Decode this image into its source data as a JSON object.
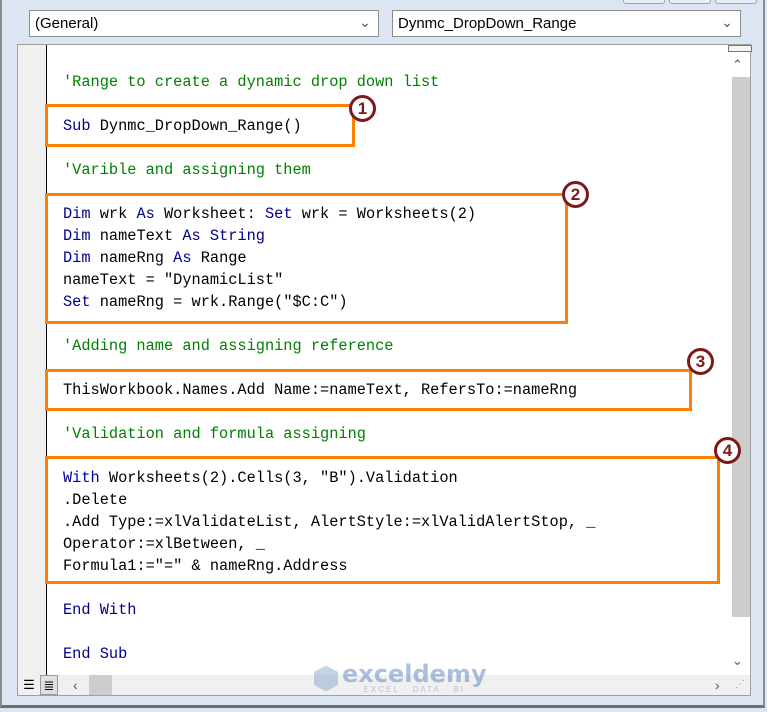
{
  "window": {
    "object_combo": "(General)",
    "procedure_combo": "Dynmc_DropDown_Range"
  },
  "code": {
    "lines": [
      {
        "segments": [
          {
            "t": "'Range to create a dynamic drop down list",
            "c": "cm"
          }
        ]
      },
      {
        "segments": [
          {
            "t": "Sub",
            "c": "kw"
          },
          {
            "t": " Dynmc_DropDown_Range()",
            "c": ""
          }
        ]
      },
      {
        "segments": [
          {
            "t": "'Varible and assigning them",
            "c": "cm"
          }
        ]
      },
      {
        "segments": [
          {
            "t": "Dim",
            "c": "kw"
          },
          {
            "t": " wrk ",
            "c": ""
          },
          {
            "t": "As",
            "c": "kw"
          },
          {
            "t": " Worksheet: ",
            "c": ""
          },
          {
            "t": "Set",
            "c": "kw"
          },
          {
            "t": " wrk = Worksheets(2)",
            "c": ""
          }
        ]
      },
      {
        "segments": [
          {
            "t": "Dim",
            "c": "kw"
          },
          {
            "t": " nameText ",
            "c": ""
          },
          {
            "t": "As",
            "c": "kw"
          },
          {
            "t": " ",
            "c": ""
          },
          {
            "t": "String",
            "c": "kw"
          }
        ]
      },
      {
        "segments": [
          {
            "t": "Dim",
            "c": "kw"
          },
          {
            "t": " nameRng ",
            "c": ""
          },
          {
            "t": "As",
            "c": "kw"
          },
          {
            "t": " Range",
            "c": ""
          }
        ]
      },
      {
        "segments": [
          {
            "t": "nameText = \"DynamicList\"",
            "c": ""
          }
        ]
      },
      {
        "segments": [
          {
            "t": "Set",
            "c": "kw"
          },
          {
            "t": " nameRng = wrk.Range(\"$C:C\")",
            "c": ""
          }
        ]
      },
      {
        "segments": [
          {
            "t": "'Adding name and assigning reference",
            "c": "cm"
          }
        ]
      },
      {
        "segments": [
          {
            "t": "ThisWorkbook.Names.Add Name:=nameText, RefersTo:=nameRng",
            "c": ""
          }
        ]
      },
      {
        "segments": [
          {
            "t": "'Validation and formula assigning",
            "c": "cm"
          }
        ]
      },
      {
        "segments": [
          {
            "t": "With",
            "c": "kw"
          },
          {
            "t": " Worksheets(2).Cells(3, \"B\").Validation",
            "c": ""
          }
        ]
      },
      {
        "segments": [
          {
            "t": ".Delete",
            "c": ""
          }
        ]
      },
      {
        "segments": [
          {
            "t": ".Add Type:=xlValidateList, AlertStyle:=xlValidAlertStop, _",
            "c": ""
          }
        ]
      },
      {
        "segments": [
          {
            "t": "Operator:=xlBetween, _",
            "c": ""
          }
        ]
      },
      {
        "segments": [
          {
            "t": "Formula1:=\"=\" & nameRng.Address",
            "c": ""
          }
        ]
      },
      {
        "segments": [
          {
            "t": "End With",
            "c": "kw"
          }
        ]
      },
      {
        "segments": [
          {
            "t": "End Sub",
            "c": "kw"
          }
        ]
      }
    ]
  },
  "annotations": {
    "badge1": "1",
    "badge2": "2",
    "badge3": "3",
    "badge4": "4"
  },
  "icons": {
    "combo_chevron": "⌄",
    "scroll_up": "⌃",
    "scroll_down": "⌄",
    "scroll_left": "‹",
    "scroll_right": "›",
    "procedure_view": "☰",
    "full_module_view": "≣",
    "resize_grip": "⋰"
  },
  "watermark": {
    "name": "exceldemy",
    "tagline": "EXCEL · DATA · BI"
  }
}
